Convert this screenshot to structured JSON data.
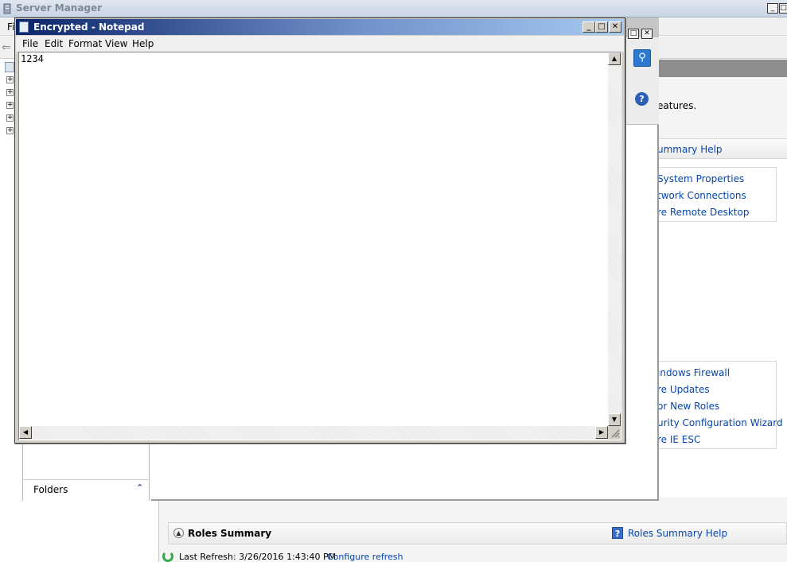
{
  "server_manager": {
    "title": "Server Manager",
    "menu_first": "Fi",
    "description_tail": "eatures.",
    "summary_help": "ummary Help",
    "links_top": [
      "System Properties",
      "twork Connections",
      "re Remote Desktop"
    ],
    "links_bottom": [
      "indows Firewall",
      "re Updates",
      "or New Roles",
      "urity Configuration Wizard",
      "re IE ESC"
    ],
    "folders_label": "Folders",
    "roles_summary": "Roles Summary",
    "roles_summary_help": "Roles Summary Help",
    "last_refresh": "Last Refresh: 3/26/2016 1:43:40 PM",
    "configure_refresh": "Configure refresh"
  },
  "notepad": {
    "title": "Encrypted - Notepad",
    "menu": [
      "File",
      "Edit",
      "Format",
      "View",
      "Help"
    ],
    "content": "1234"
  },
  "icons": {
    "search": "search-icon",
    "help": "help-icon",
    "refresh": "refresh-icon"
  }
}
